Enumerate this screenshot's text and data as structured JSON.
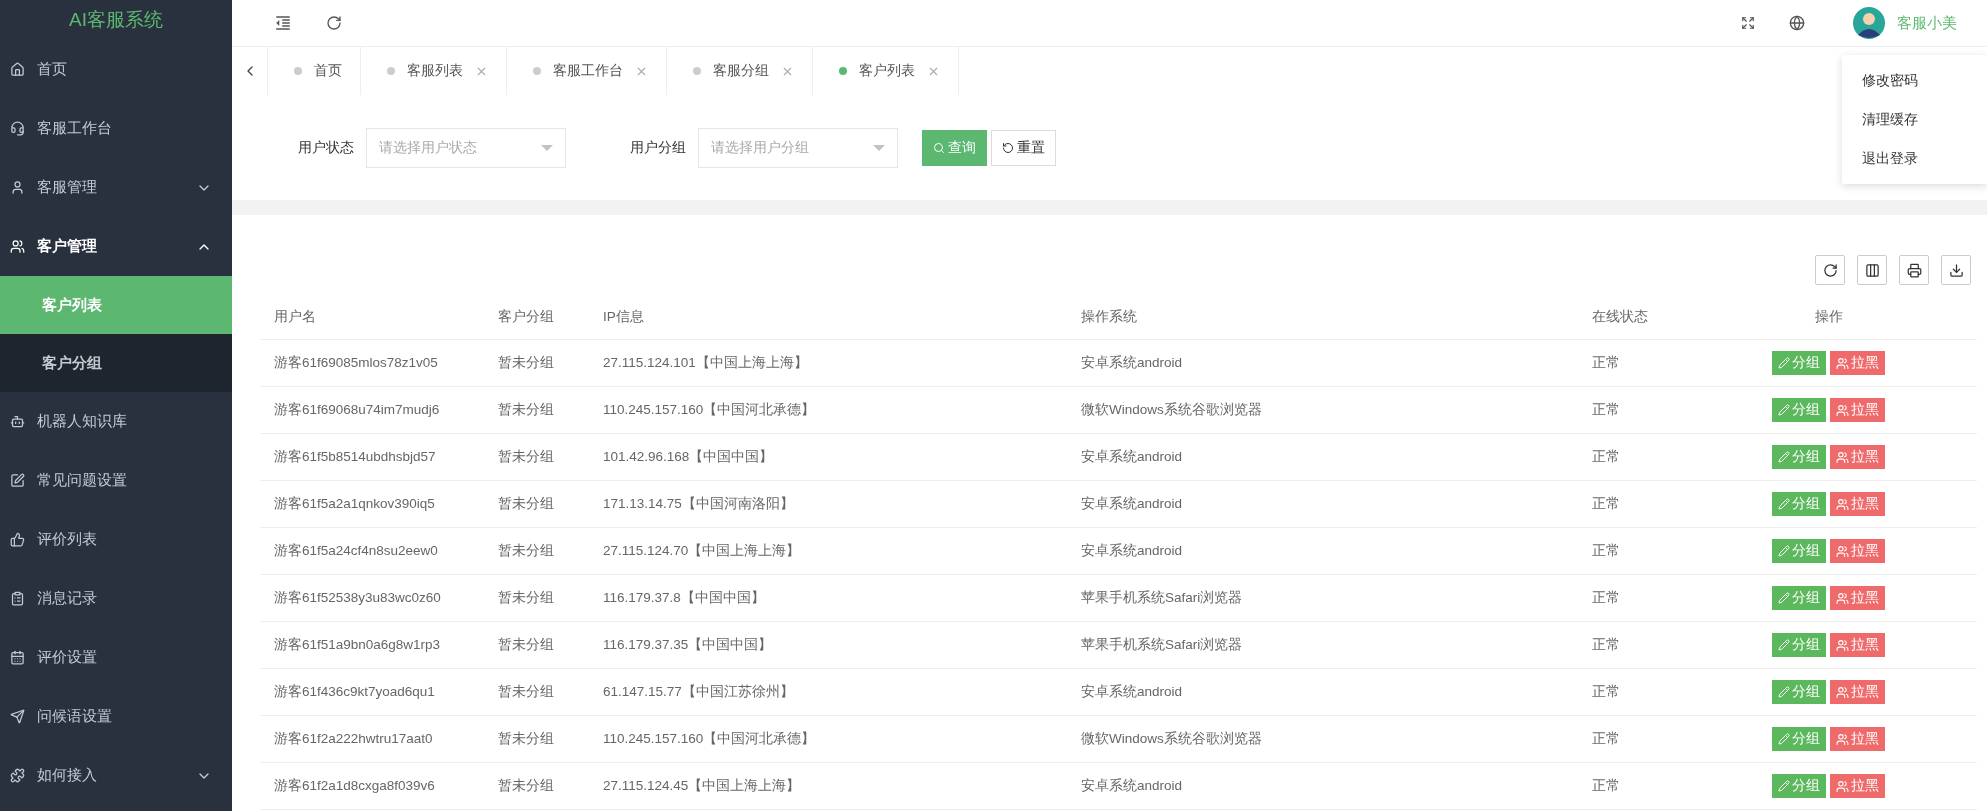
{
  "app_title": "AI客服系统",
  "header": {
    "user_name": "客服小美"
  },
  "user_menu": [
    {
      "label": "修改密码"
    },
    {
      "label": "清理缓存"
    },
    {
      "label": "退出登录"
    }
  ],
  "sidebar": {
    "items": [
      {
        "label": "首页",
        "selected": false
      },
      {
        "label": "客服工作台",
        "selected": false
      },
      {
        "label": "客服管理",
        "selected": false,
        "expanded": false
      },
      {
        "label": "客户管理",
        "selected": false,
        "expanded": true,
        "children": [
          {
            "label": "客户列表",
            "selected": true
          },
          {
            "label": "客户分组",
            "selected": false
          }
        ]
      },
      {
        "label": "机器人知识库",
        "selected": false
      },
      {
        "label": "常见问题设置",
        "selected": false
      },
      {
        "label": "评价列表",
        "selected": false
      },
      {
        "label": "消息记录",
        "selected": false
      },
      {
        "label": "评价设置",
        "selected": false
      },
      {
        "label": "问候语设置",
        "selected": false
      },
      {
        "label": "如何接入",
        "selected": false,
        "expanded": false
      }
    ]
  },
  "tabs": [
    {
      "label": "首页",
      "closable": false,
      "selected": false
    },
    {
      "label": "客服列表",
      "closable": true,
      "selected": false
    },
    {
      "label": "客服工作台",
      "closable": true,
      "selected": false
    },
    {
      "label": "客服分组",
      "closable": true,
      "selected": false
    },
    {
      "label": "客户列表",
      "closable": true,
      "selected": true
    }
  ],
  "filters": [
    {
      "label": "用户状态",
      "placeholder": "请选择用户状态"
    },
    {
      "label": "用户分组",
      "placeholder": "请选择用户分组"
    }
  ],
  "filter_buttons": [
    {
      "kind": "search",
      "label": "查询"
    },
    {
      "kind": "reset",
      "label": "重置"
    }
  ],
  "table": {
    "columns": [
      "用户名",
      "客户分组",
      "IP信息",
      "操作系统",
      "在线状态",
      "操作"
    ],
    "rows": [
      {
        "cells": [
          "游客61f69085mlos78z1v05",
          "暂未分组",
          "27.115.124.101【中国上海上海】",
          "安卓系统android",
          "正常"
        ],
        "actions": [
          {
            "kind": "edit",
            "label": "分组"
          },
          {
            "kind": "block",
            "label": "拉黑"
          }
        ]
      },
      {
        "cells": [
          "游客61f69068u74im7mudj6",
          "暂未分组",
          "110.245.157.160【中国河北承德】",
          "微软Windows系统谷歌浏览器",
          "正常"
        ],
        "actions": [
          {
            "kind": "edit",
            "label": "分组"
          },
          {
            "kind": "block",
            "label": "拉黑"
          }
        ]
      },
      {
        "cells": [
          "游客61f5b8514ubdhsbjd57",
          "暂未分组",
          "101.42.96.168【中国中国】",
          "安卓系统android",
          "正常"
        ],
        "actions": [
          {
            "kind": "edit",
            "label": "分组"
          },
          {
            "kind": "block",
            "label": "拉黑"
          }
        ]
      },
      {
        "cells": [
          "游客61f5a2a1qnkov390iq5",
          "暂未分组",
          "171.13.14.75【中国河南洛阳】",
          "安卓系统android",
          "正常"
        ],
        "actions": [
          {
            "kind": "edit",
            "label": "分组"
          },
          {
            "kind": "block",
            "label": "拉黑"
          }
        ]
      },
      {
        "cells": [
          "游客61f5a24cf4n8su2eew0",
          "暂未分组",
          "27.115.124.70【中国上海上海】",
          "安卓系统android",
          "正常"
        ],
        "actions": [
          {
            "kind": "edit",
            "label": "分组"
          },
          {
            "kind": "block",
            "label": "拉黑"
          }
        ]
      },
      {
        "cells": [
          "游客61f52538y3u83wc0z60",
          "暂未分组",
          "116.179.37.8【中国中国】",
          "苹果手机系统Safari浏览器",
          "正常"
        ],
        "actions": [
          {
            "kind": "edit",
            "label": "分组"
          },
          {
            "kind": "block",
            "label": "拉黑"
          }
        ]
      },
      {
        "cells": [
          "游客61f51a9bn0a6g8w1rp3",
          "暂未分组",
          "116.179.37.35【中国中国】",
          "苹果手机系统Safari浏览器",
          "正常"
        ],
        "actions": [
          {
            "kind": "edit",
            "label": "分组"
          },
          {
            "kind": "block",
            "label": "拉黑"
          }
        ]
      },
      {
        "cells": [
          "游客61f436c9kt7yoad6qu1",
          "暂未分组",
          "61.147.15.77【中国江苏徐州】",
          "安卓系统android",
          "正常"
        ],
        "actions": [
          {
            "kind": "edit",
            "label": "分组"
          },
          {
            "kind": "block",
            "label": "拉黑"
          }
        ]
      },
      {
        "cells": [
          "游客61f2a222hwtru17aat0",
          "暂未分组",
          "110.245.157.160【中国河北承德】",
          "微软Windows系统谷歌浏览器",
          "正常"
        ],
        "actions": [
          {
            "kind": "edit",
            "label": "分组"
          },
          {
            "kind": "block",
            "label": "拉黑"
          }
        ]
      },
      {
        "cells": [
          "游客61f2a1d8cxga8f039v6",
          "暂未分组",
          "27.115.124.45【中国上海上海】",
          "安卓系统android",
          "正常"
        ],
        "actions": [
          {
            "kind": "edit",
            "label": "分组"
          },
          {
            "kind": "block",
            "label": "拉黑"
          }
        ]
      }
    ]
  }
}
